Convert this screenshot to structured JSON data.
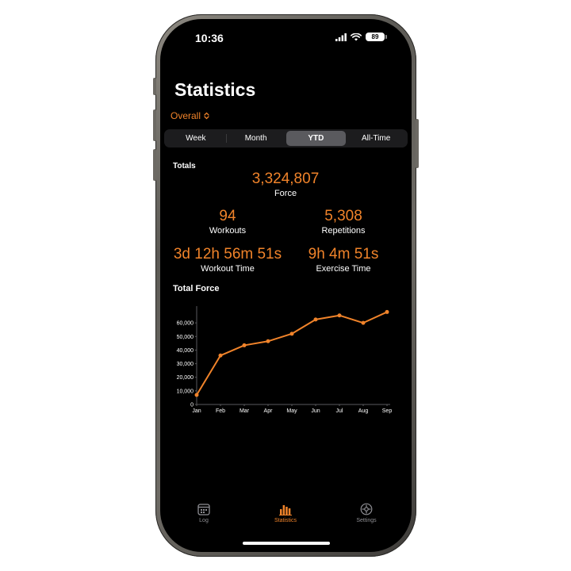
{
  "status_bar": {
    "time": "10:36",
    "battery": "89"
  },
  "header": {
    "title": "Statistics",
    "filter_label": "Overall"
  },
  "segments": [
    {
      "label": "Week",
      "active": false
    },
    {
      "label": "Month",
      "active": false
    },
    {
      "label": "YTD",
      "active": true
    },
    {
      "label": "All-Time",
      "active": false
    }
  ],
  "totals": {
    "section_label": "Totals",
    "force": {
      "value": "3,324,807",
      "label": "Force"
    },
    "workouts": {
      "value": "94",
      "label": "Workouts"
    },
    "repetitions": {
      "value": "5,308",
      "label": "Repetitions"
    },
    "workout_time": {
      "value": "3d 12h 56m 51s",
      "label": "Workout Time"
    },
    "exercise_time": {
      "value": "9h 4m 51s",
      "label": "Exercise Time"
    }
  },
  "chart_section_label": "Total Force",
  "chart_data": {
    "type": "line",
    "title": "",
    "xlabel": "",
    "ylabel": "",
    "categories": [
      "Jan",
      "Feb",
      "Mar",
      "Apr",
      "May",
      "Jun",
      "Jul",
      "Aug",
      "Sep"
    ],
    "values": [
      7000,
      36000,
      43500,
      46500,
      52000,
      62500,
      65500,
      60000,
      68000
    ],
    "yticks": [
      "0",
      "10,000",
      "20,000",
      "30,000",
      "40,000",
      "50,000",
      "60,000"
    ],
    "ylim": [
      0,
      70000
    ],
    "color": "#f0832a",
    "grid": false
  },
  "tabbar": [
    {
      "label": "Log",
      "icon": "calendar-icon",
      "active": false
    },
    {
      "label": "Statistics",
      "icon": "bar-chart-icon",
      "active": true
    },
    {
      "label": "Settings",
      "icon": "gear-icon",
      "active": false
    }
  ]
}
